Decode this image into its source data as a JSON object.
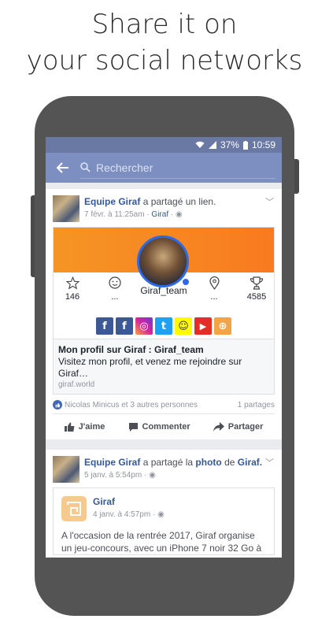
{
  "headline": {
    "line1": "Share it on",
    "line2": "your social networks"
  },
  "statusbar": {
    "battery": "37%",
    "time": "10:59"
  },
  "appbar": {
    "search_placeholder": "Rechercher"
  },
  "post1": {
    "author": "Equipe Giraf",
    "action": "a partagé un lien.",
    "date": "7 févr. à 11:25am",
    "group": "Giraf",
    "profile": {
      "username": "Giraf_team",
      "stats": [
        {
          "icon": "star-icon",
          "value": "146"
        },
        {
          "icon": "smiley-icon",
          "value": "..."
        },
        {
          "icon": "location-icon",
          "value": "..."
        },
        {
          "icon": "trophy-icon",
          "value": "4585"
        }
      ],
      "socials": [
        {
          "name": "facebook-icon",
          "glyph": "f",
          "color": "#3b5998"
        },
        {
          "name": "facebook-icon-2",
          "glyph": "f",
          "color": "#3b5998"
        },
        {
          "name": "instagram-icon",
          "glyph": "◎",
          "color": "#c13584"
        },
        {
          "name": "twitter-icon",
          "glyph": "t",
          "color": "#1da1f2"
        },
        {
          "name": "snapchat-icon",
          "glyph": "☺",
          "color": "#fffc00"
        },
        {
          "name": "youtube-icon",
          "glyph": "▶",
          "color": "#e52d27"
        },
        {
          "name": "web-icon",
          "glyph": "⊕",
          "color": "#f4a445"
        }
      ]
    },
    "link": {
      "title": "Mon profil sur Giraf : Giraf_team",
      "description": "Visitez mon profil, et venez me rejoindre sur Giraf…",
      "domain": "giraf.world"
    },
    "reactions": {
      "likes": "Nicolas Minicus et 3 autres personnes",
      "shares": "1 partages"
    },
    "actions": {
      "like": "J'aime",
      "comment": "Commenter",
      "share": "Partager"
    }
  },
  "post2": {
    "author": "Equipe Giraf",
    "action1": "a partagé la",
    "object": "photo",
    "action2": "de",
    "target": "Giraf.",
    "date": "5 janv. à 5:54pm",
    "quoted": {
      "name": "Giraf",
      "date": "4 janv. à 4:57pm",
      "text": "A l'occasion de la rentrée 2017, Giraf organise un jeu-concours, avec un iPhone 7 noir 32 Go à"
    }
  },
  "colors": {
    "statusbar": "#6a79a3",
    "appbar": "#7d8fc0",
    "banner": "#f58a22",
    "fb_blue": "#365899"
  }
}
